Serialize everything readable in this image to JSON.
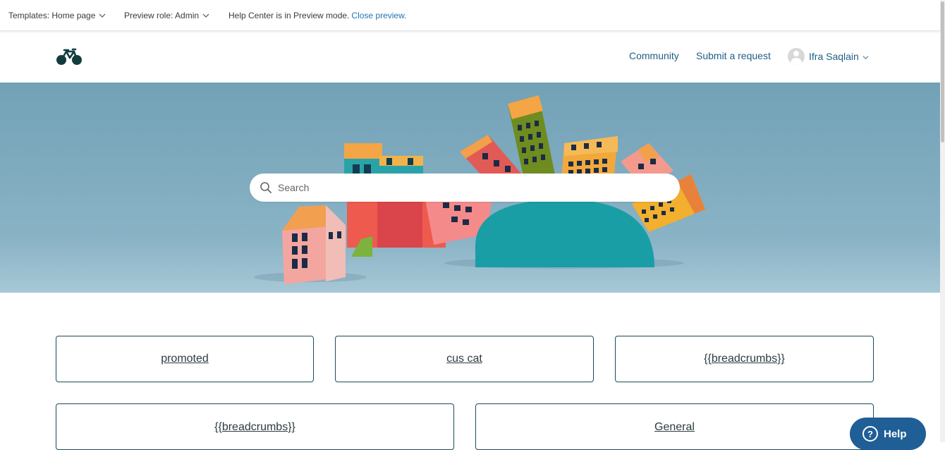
{
  "preview_bar": {
    "templates_label": "Templates: Home page",
    "role_label": "Preview role: Admin",
    "message": "Help Center is in Preview mode.",
    "close_link": "Close preview."
  },
  "header": {
    "logo_icon": "bicycle-logo-icon",
    "nav": {
      "community": "Community",
      "submit_request": "Submit a request"
    },
    "user": {
      "name": "Ifra Saqlain",
      "avatar_icon": "user-avatar-icon"
    }
  },
  "hero": {
    "search": {
      "placeholder": "Search",
      "icon": "search-icon"
    }
  },
  "blocks": [
    {
      "label": "promoted"
    },
    {
      "label": "cus cat"
    },
    {
      "label": "{{breadcrumbs}}"
    },
    {
      "label": "{{breadcrumbs}}"
    },
    {
      "label": "General"
    }
  ],
  "help_widget": {
    "label": "Help",
    "icon": "question-icon"
  },
  "colors": {
    "link": "#1f5f86",
    "preview_link": "#1f73b7",
    "block_border": "#1b4b5a",
    "help_button": "#1f5f96",
    "hero_bg": "#7aa5b8"
  }
}
